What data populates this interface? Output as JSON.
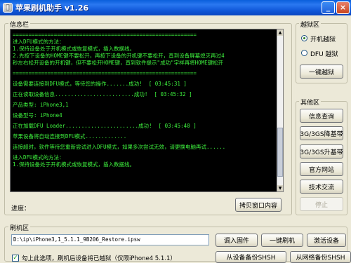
{
  "window": {
    "title": "苹果刷机助手  v1.26",
    "minimize_label": "_",
    "close_label": "×"
  },
  "info_panel": {
    "label": "信息栏",
    "console_lines": [
      "==========================================================",
      "进入DFU模式的方法：",
      "1.保持设备处于开机模式或恢复模式，插入数据线。",
      "2.先按下设备的HOME键不要松开，再按下设备的开机键不要松开，直到设备屏幕熄灭再过4",
      "秒左右松开设备的开机键，但不要松开HOME键，直到软件提示\"成功\"字样再将HOME键松开",
      "",
      "==========================================================",
      "",
      "设备需要连接到DFU模式，等待您的操作.......成功!  [ 03:45:31 ]",
      "",
      "正在读取设备信息.........................成功!  [ 03:45:32 ]",
      "",
      "产品类型: iPhone3,1",
      "",
      "设备型号: iPhone4",
      "",
      "正在加载DFU Loader.......................成功!  [ 03:45:40 ]",
      "",
      "苹果设备将自动连接到DFU模式.............",
      "",
      "连接超时，软件等待您重新尝试进入DFU模式，如果多次尝试无效，请更换电脑再试......",
      "",
      "进入DFU模式的方法：",
      "1.保持设备处于开机模式或恢复模式，插入数据线。"
    ],
    "progress_label": "进度：",
    "copy_button": "拷贝窗口内容"
  },
  "jailbreak_panel": {
    "label": "越狱区",
    "option_boot": "开机越狱",
    "option_dfu": "DFU 越狱",
    "selected": "开机越狱",
    "one_click_button": "一键越狱"
  },
  "other_panel": {
    "label": "其他区",
    "buttons": [
      "信息查询",
      "3G/3GS降基带",
      "3G/3GS升基带",
      "官方网站",
      "技术交流",
      "停止"
    ]
  },
  "flash_panel": {
    "label": "刷机区",
    "firmware_path": "D:\\ip\\iPhone3,1_5.1.1_9B206_Restore.ipsw",
    "import_button": "调入固件",
    "one_click_flash_button": "一键刷机",
    "activate_button": "激活设备",
    "jailbreak_checkbox_label": "勾上此选项，刷机后设备将已越狱（仅限iPhone4 5.1.1）",
    "jailbreak_checked": true,
    "backup_from_device_button": "从设备备份SHSH",
    "backup_from_network_button": "从网络备份SHSH"
  }
}
